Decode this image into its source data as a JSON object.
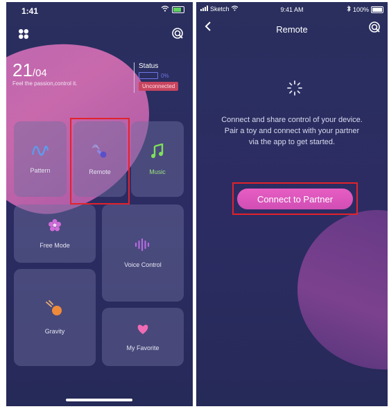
{
  "left": {
    "status_bar": {
      "time": "1:41"
    },
    "date": {
      "day": "21",
      "month": "/04"
    },
    "tagline": "Feel the passion,control it.",
    "status": {
      "title": "Status",
      "percent": "0%",
      "state": "Unconnected"
    },
    "tiles": [
      {
        "id": "pattern",
        "label": "Pattern",
        "icon": "wave-icon"
      },
      {
        "id": "remote",
        "label": "Remote",
        "icon": "remote-icon"
      },
      {
        "id": "music",
        "label": "Music",
        "icon": "music-note-icon"
      },
      {
        "id": "free_mode",
        "label": "Free Mode",
        "icon": "flower-icon"
      },
      {
        "id": "voice_control",
        "label": "Voice Control",
        "icon": "sound-wave-icon"
      },
      {
        "id": "gravity",
        "label": "Gravity",
        "icon": "ball-icon"
      },
      {
        "id": "my_favorite",
        "label": "My Favorite",
        "icon": "heart-icon"
      }
    ]
  },
  "right": {
    "status_bar": {
      "carrier": "Sketch",
      "time": "9:41 AM",
      "battery": "100%"
    },
    "nav_title": "Remote",
    "description": [
      "Connect and share control of your device.",
      "Pair a toy and connect with your partner",
      "via the app to get started."
    ],
    "connect_button": "Connect to Partner"
  },
  "colors": {
    "accent_pink": "#d957b8",
    "highlight_red": "#e3222b",
    "background": "#2a2f5e"
  }
}
